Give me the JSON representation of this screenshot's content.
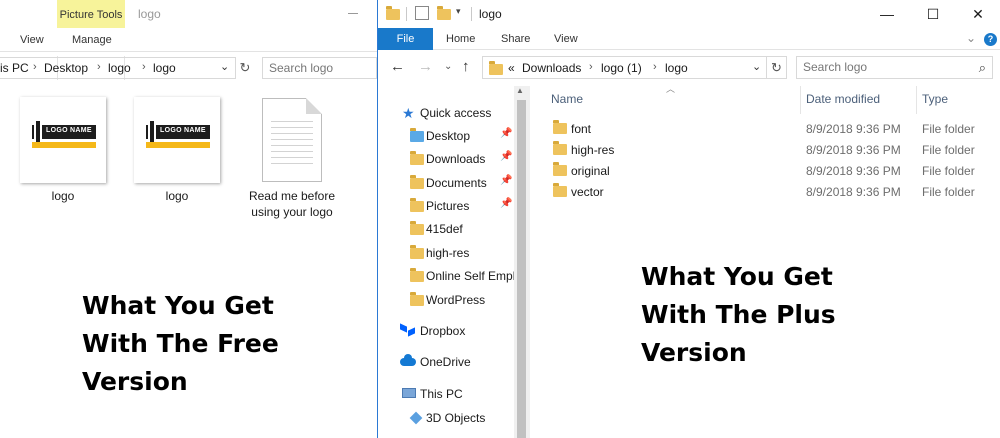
{
  "left_window": {
    "context_tab": "Picture Tools",
    "title": "logo",
    "tabs": {
      "view": "View",
      "manage": "Manage"
    },
    "breadcrumb": [
      "is PC",
      "Desktop",
      "logo",
      "logo"
    ],
    "search_placeholder": "Search logo",
    "files": [
      {
        "name": "logo",
        "thumb_text": "LOGO NAME"
      },
      {
        "name": "logo",
        "thumb_text": "LOGO NAME"
      },
      {
        "name": "Read me before\nusing your logo"
      }
    ],
    "caption": "What You Get\nWith The Free\nVersion"
  },
  "right_window": {
    "title": "logo",
    "window_controls": {
      "minimize": "—",
      "maximize": "☐",
      "close": "✕"
    },
    "ribbon": {
      "file": "File",
      "home": "Home",
      "share": "Share",
      "view": "View",
      "help": "?"
    },
    "breadcrumb": [
      "«",
      "Downloads",
      "logo (1)",
      "logo"
    ],
    "search_placeholder": "Search logo",
    "nav_pane": [
      {
        "label": "Quick access",
        "icon": "star-icon",
        "top": true
      },
      {
        "label": "Desktop",
        "pinned": true
      },
      {
        "label": "Downloads",
        "pinned": true
      },
      {
        "label": "Documents",
        "pinned": true
      },
      {
        "label": "Pictures",
        "pinned": true
      },
      {
        "label": "415def"
      },
      {
        "label": "high-res"
      },
      {
        "label": "Online Self Empl"
      },
      {
        "label": "WordPress"
      },
      {
        "label": "Dropbox",
        "icon": "dropbox-icon",
        "top": true
      },
      {
        "label": "OneDrive",
        "icon": "onedrive-icon",
        "top": true
      },
      {
        "label": "This PC",
        "icon": "this-pc-icon",
        "top": true
      },
      {
        "label": "3D Objects",
        "icon": "3d-objects-icon"
      }
    ],
    "columns": {
      "name": "Name",
      "date": "Date modified",
      "type": "Type"
    },
    "rows": [
      {
        "name": "font",
        "date": "8/9/2018 9:36 PM",
        "type": "File folder"
      },
      {
        "name": "high-res",
        "date": "8/9/2018 9:36 PM",
        "type": "File folder"
      },
      {
        "name": "original",
        "date": "8/9/2018 9:36 PM",
        "type": "File folder"
      },
      {
        "name": "vector",
        "date": "8/9/2018 9:36 PM",
        "type": "File folder"
      }
    ],
    "caption": "What You Get\nWith The Plus\nVersion"
  }
}
